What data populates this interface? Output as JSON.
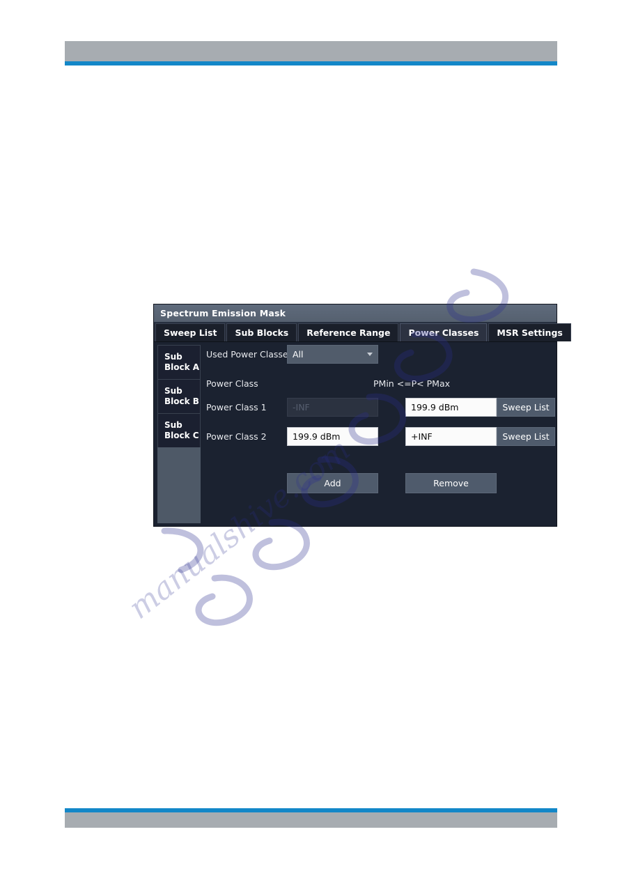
{
  "dialog": {
    "title": "Spectrum Emission Mask",
    "tabs": [
      {
        "label": "Sweep List",
        "selected": false
      },
      {
        "label": "Sub Blocks",
        "selected": false
      },
      {
        "label": "Reference Range",
        "selected": false
      },
      {
        "label": "Power Classes",
        "selected": true
      },
      {
        "label": "MSR Settings",
        "selected": false
      }
    ],
    "sidebar": {
      "items": [
        {
          "label_line1": "Sub",
          "label_line2": "Block A"
        },
        {
          "label_line1": "Sub",
          "label_line2": "Block B"
        },
        {
          "label_line1": "Sub",
          "label_line2": "Block C"
        }
      ]
    },
    "form": {
      "used_power_classes_label": "Used Power Classes:",
      "used_power_classes_value": "All",
      "power_class_label": "Power Class",
      "range_header": "PMin <=P< PMax",
      "rows": [
        {
          "label": "Power Class 1",
          "min_value": "-INF",
          "min_enabled": false,
          "max_value": "199.9 dBm",
          "max_enabled": true,
          "sweep_list_label": "Sweep List"
        },
        {
          "label": "Power Class 2",
          "min_value": "199.9 dBm",
          "min_enabled": true,
          "max_value": "+INF",
          "max_enabled": true,
          "sweep_list_label": "Sweep List"
        }
      ],
      "add_label": "Add",
      "remove_label": "Remove"
    },
    "colors": {
      "titlebar": "#5c6878",
      "dialog_bg": "#1c2230",
      "tab_selected_bg": "#2c3241",
      "button_bg": "#4f5b6c",
      "dropdown_bg": "#515c6b",
      "page_accent": "#1387c8",
      "page_band": "#a7acb1"
    }
  }
}
